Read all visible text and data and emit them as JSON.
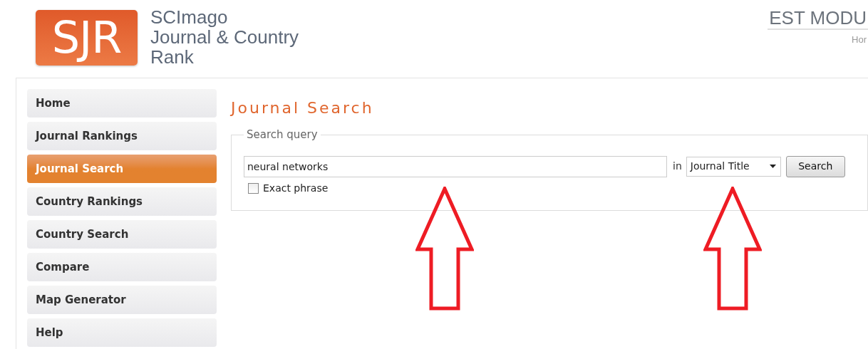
{
  "logo": {
    "mark": "SJR",
    "title_lines": [
      "SCImago",
      "Journal & Country",
      "Rank"
    ]
  },
  "header_right": {
    "title": "EST MODU",
    "link": "Hor"
  },
  "sidebar": {
    "items": [
      {
        "label": "Home",
        "selected": false
      },
      {
        "label": "Journal Rankings",
        "selected": false
      },
      {
        "label": "Journal Search",
        "selected": true
      },
      {
        "label": "Country Rankings",
        "selected": false
      },
      {
        "label": "Country Search",
        "selected": false
      },
      {
        "label": "Compare",
        "selected": false
      },
      {
        "label": "Map Generator",
        "selected": false
      },
      {
        "label": "Help",
        "selected": false
      }
    ]
  },
  "content": {
    "heading": "Journal Search",
    "search_query": {
      "legend": "Search query",
      "value": "neural networks",
      "in_label": "in",
      "field_select": "Journal Title",
      "button": "Search",
      "exact_phrase": {
        "label": "Exact phrase",
        "checked": false
      }
    }
  },
  "annotations": [
    {
      "kind": "up_arrow"
    },
    {
      "kind": "up_arrow"
    }
  ]
}
